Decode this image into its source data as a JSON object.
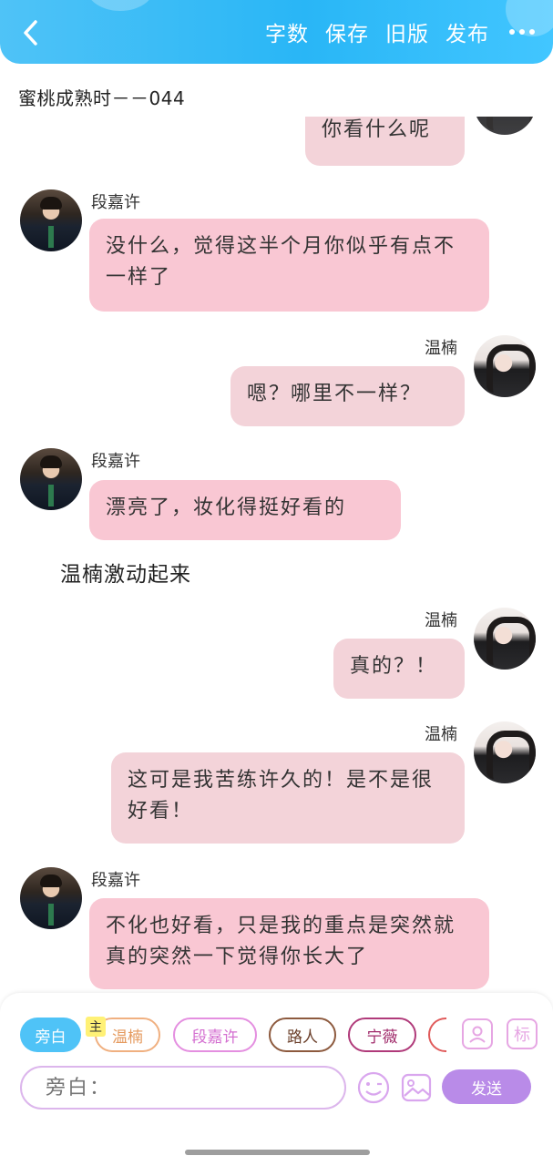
{
  "header": {
    "actions": [
      "字数",
      "保存",
      "旧版",
      "发布"
    ]
  },
  "document": {
    "title": "蜜桃成熟时－－044"
  },
  "messages": [
    {
      "text": "你看什么呢"
    },
    {
      "name": "段嘉许",
      "text": "没什么，觉得这半个月你似乎有点不一样了"
    },
    {
      "name": "温楠",
      "text": "嗯？哪里不一样？"
    },
    {
      "name": "段嘉许",
      "text": "漂亮了，妆化得挺好看的"
    },
    {
      "narration": "温楠激动起来"
    },
    {
      "name": "温楠",
      "text": "真的？！"
    },
    {
      "name": "温楠",
      "text": "这可是我苦练许久的！是不是很好看！"
    },
    {
      "name": "段嘉许",
      "text": "不化也好看，只是我的重点是突然就真的突然一下觉得你长大了"
    }
  ],
  "composer": {
    "role_chips": [
      "旁白",
      "温楠",
      "段嘉许",
      "路人",
      "宁薇"
    ],
    "main_badge": "主",
    "mark_label": "标",
    "input_placeholder": "旁白：",
    "send_label": "发送"
  },
  "colors": {
    "header_blue": "#29b6f6",
    "bubble_pink": "#f9c7d3",
    "send_purple": "#b98be8"
  }
}
